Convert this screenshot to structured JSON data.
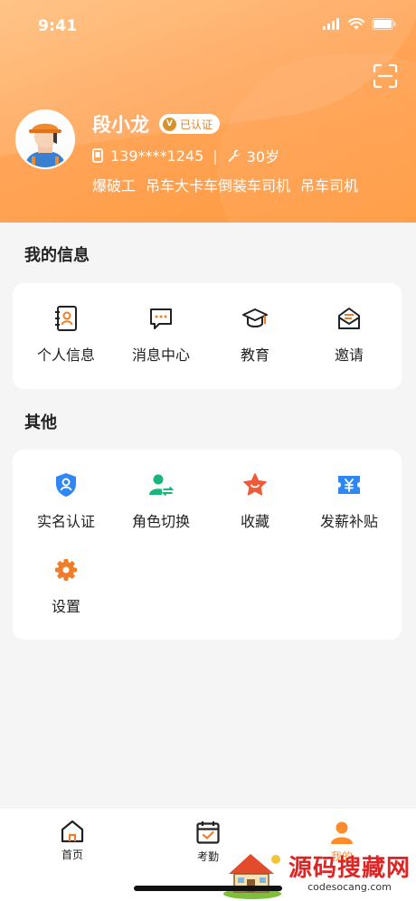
{
  "status": {
    "time": "9:41"
  },
  "profile": {
    "name": "段小龙",
    "verified_label": "已认证",
    "phone": "139****1245",
    "age": "30岁",
    "tags": [
      "爆破工",
      "吊车大卡车倒装车司机",
      "吊车司机"
    ]
  },
  "my_info": {
    "title": "我的信息",
    "items": [
      {
        "label": "个人信息",
        "icon": "contact-book-icon"
      },
      {
        "label": "消息中心",
        "icon": "message-bubble-icon"
      },
      {
        "label": "教育",
        "icon": "graduation-cap-icon"
      },
      {
        "label": "邀请",
        "icon": "envelope-icon"
      }
    ]
  },
  "other": {
    "title": "其他",
    "items": [
      {
        "label": "实名认证",
        "icon": "shield-user-icon",
        "color": "#2f86f6"
      },
      {
        "label": "角色切换",
        "icon": "user-switch-icon",
        "color": "#18b779"
      },
      {
        "label": "收藏",
        "icon": "star-icon",
        "color": "#f05a36"
      },
      {
        "label": "发薪补贴",
        "icon": "yuan-ticket-icon",
        "color": "#2f86f6"
      },
      {
        "label": "设置",
        "icon": "gear-icon",
        "color": "#f07d2a"
      }
    ]
  },
  "tabbar": {
    "items": [
      {
        "label": "首页",
        "icon": "home-icon"
      },
      {
        "label": "考勤",
        "icon": "calendar-check-icon"
      },
      {
        "label": "我的",
        "icon": "user-icon",
        "active": true,
        "color": "#ff8a2b"
      }
    ]
  },
  "watermark": {
    "title": "源码搜藏网",
    "url": "codesocang.com"
  }
}
